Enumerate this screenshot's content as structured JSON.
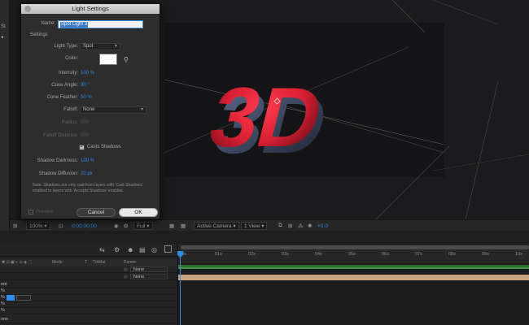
{
  "dialog": {
    "title": "Light Settings",
    "name_label": "Name:",
    "name_value": "Spot Light 3",
    "section": "Settings",
    "light_type_label": "Light Type:",
    "light_type_value": "Spot",
    "color_label": "Color:",
    "color_value": "#ffffff",
    "intensity_label": "Intensity:",
    "intensity_value": "100 %",
    "cone_angle_label": "Cone Angle:",
    "cone_angle_value": "90 °",
    "cone_feather_label": "Cone Feather:",
    "cone_feather_value": "50 %",
    "falloff_label": "Falloff:",
    "falloff_value": "None",
    "radius_label": "Radius:",
    "radius_value": "500",
    "falloff_distance_label": "Falloff Distance:",
    "falloff_distance_value": "500",
    "casts_shadows_label": "Casts Shadows",
    "shadow_darkness_label": "Shadow Darkness:",
    "shadow_darkness_value": "100 %",
    "shadow_diffusion_label": "Shadow Diffusion:",
    "shadow_diffusion_value": "20 px",
    "note": "Note: Shadows are only cast from layers with 'Cast Shadows' enabled to layers with 'Accepts Shadows' enabled.",
    "preview_label": "Preview",
    "cancel_label": "Cancel",
    "ok_label": "OK"
  },
  "viewer": {
    "text_3d": "3D",
    "zoom": "100%",
    "timecode": "0;00;00;00",
    "resolution": "Full",
    "camera": "Active Camera",
    "views": "1 View",
    "exposure": "+0.0"
  },
  "timeline": {
    "columns": {
      "mode": "Mode",
      "t": "T",
      "trkmat": "TrkMat",
      "parent": "Parent"
    },
    "layers": [
      {
        "parent": "None"
      },
      {
        "parent": "None"
      }
    ],
    "ruler_ticks": [
      "0s",
      "01s",
      "02s",
      "03s",
      "04s",
      "05s",
      "06s",
      "07s",
      "08s",
      "09s",
      "10s"
    ],
    "left_rows": [
      "oot",
      "%",
      "%",
      "%",
      "%",
      "one"
    ]
  },
  "colors": {
    "accent": "#2d8ceb",
    "track_green": "#3f7d3c",
    "track_tan": "#caa37f",
    "text_red": "#e0283b"
  }
}
